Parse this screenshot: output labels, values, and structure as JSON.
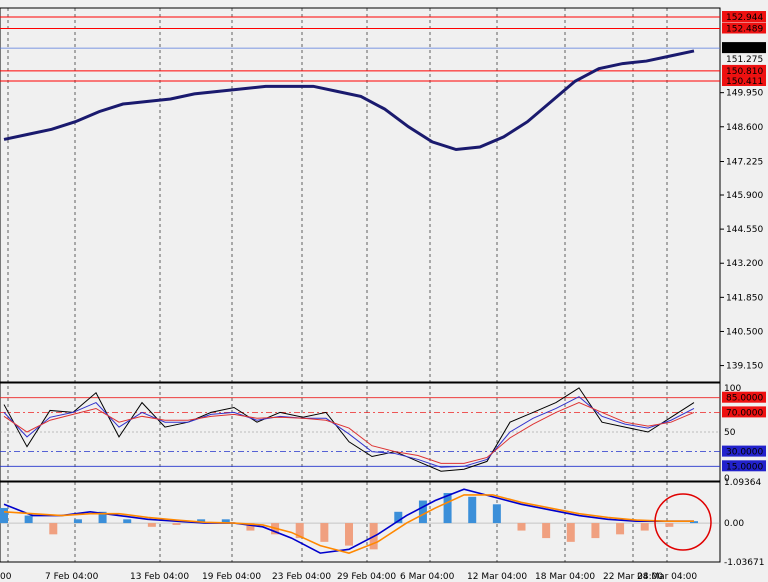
{
  "chart_data": [
    {
      "type": "line",
      "panel": "price",
      "ylim": [
        138.5,
        153.3
      ],
      "y_ticks": [
        "149.950",
        "148.600",
        "147.225",
        "145.900",
        "144.550",
        "143.200",
        "141.850",
        "140.500",
        "139.150"
      ],
      "price_labels": [
        {
          "value": 152.944,
          "text": "152.944",
          "style": "red"
        },
        {
          "value": 152.489,
          "text": "152.489",
          "style": "red"
        },
        {
          "value": 151.713,
          "text": "151.713",
          "style": "current"
        },
        {
          "value": 151.275,
          "text": "151.275",
          "style": "plain"
        },
        {
          "value": 150.81,
          "text": "150.810",
          "style": "red"
        },
        {
          "value": 150.411,
          "text": "150.411",
          "style": "red"
        }
      ],
      "horizontal_lines": [
        152.944,
        152.489,
        150.81,
        150.411
      ],
      "current_price_line": 151.713,
      "series": [
        {
          "color": "#1a1a6e",
          "values": [
            148.1,
            148.3,
            148.5,
            148.8,
            149.2,
            149.5,
            149.6,
            149.7,
            149.9,
            150.0,
            150.1,
            150.2,
            150.2,
            150.2,
            150.0,
            149.8,
            149.3,
            148.6,
            148.0,
            147.7,
            147.8,
            148.2,
            148.8,
            149.6,
            150.4,
            150.9,
            151.1,
            151.2,
            151.4,
            151.6
          ]
        }
      ],
      "x_index_range": [
        0,
        29
      ],
      "color_accent": "#ff0000",
      "background": "#f0f0f0"
    },
    {
      "type": "line",
      "panel": "stochastic",
      "ylim": [
        0,
        100
      ],
      "y_ticks": [
        "100",
        "50",
        "0"
      ],
      "levels": [
        {
          "value": 85,
          "text": "85.0000",
          "style": "red"
        },
        {
          "value": 70,
          "text": "70.0000",
          "style": "red"
        },
        {
          "value": 30,
          "text": "30.0000",
          "style": "blue"
        },
        {
          "value": 15,
          "text": "15.0000",
          "style": "blue"
        }
      ],
      "series": [
        {
          "color": "#000000",
          "values": [
            78,
            35,
            72,
            70,
            90,
            45,
            80,
            55,
            60,
            70,
            75,
            60,
            70,
            65,
            70,
            40,
            25,
            30,
            20,
            10,
            12,
            20,
            60,
            70,
            80,
            95,
            60,
            55,
            50,
            65,
            80
          ]
        },
        {
          "color": "#3333cc",
          "values": [
            70,
            45,
            65,
            70,
            80,
            55,
            70,
            60,
            60,
            68,
            70,
            62,
            66,
            64,
            64,
            48,
            30,
            28,
            22,
            14,
            15,
            22,
            50,
            64,
            74,
            86,
            66,
            58,
            54,
            62,
            74
          ]
        },
        {
          "color": "#dd3333",
          "values": [
            66,
            50,
            62,
            68,
            74,
            60,
            66,
            62,
            62,
            66,
            68,
            64,
            65,
            64,
            62,
            54,
            36,
            30,
            26,
            18,
            18,
            24,
            44,
            58,
            70,
            80,
            70,
            60,
            56,
            60,
            70
          ]
        }
      ]
    },
    {
      "type": "bar",
      "panel": "macd",
      "ylim": [
        -1.03671,
        1.09364
      ],
      "y_ticks": [
        "1.09364",
        "0.00",
        "-1.03671"
      ],
      "histogram": [
        0.4,
        0.2,
        -0.3,
        0.1,
        0.3,
        0.1,
        -0.1,
        -0.05,
        0.1,
        0.1,
        -0.2,
        -0.3,
        -0.4,
        -0.5,
        -0.6,
        -0.7,
        0.3,
        0.6,
        0.8,
        0.7,
        0.5,
        -0.2,
        -0.4,
        -0.5,
        -0.4,
        -0.3,
        -0.2,
        -0.1,
        0.05
      ],
      "series": [
        {
          "color": "#0000cc",
          "values": [
            0.5,
            0.2,
            0.2,
            0.3,
            0.2,
            0.1,
            0.05,
            0.0,
            0.0,
            -0.1,
            -0.4,
            -0.8,
            -0.7,
            -0.3,
            0.2,
            0.6,
            0.9,
            0.7,
            0.5,
            0.35,
            0.2,
            0.1,
            0.05,
            0.05,
            0.05
          ]
        },
        {
          "color": "#ff8800",
          "values": [
            0.3,
            0.25,
            0.2,
            0.25,
            0.25,
            0.15,
            0.08,
            0.02,
            0.0,
            -0.05,
            -0.25,
            -0.6,
            -0.8,
            -0.5,
            0.0,
            0.4,
            0.75,
            0.75,
            0.55,
            0.4,
            0.25,
            0.15,
            0.08,
            0.05,
            0.05
          ]
        }
      ]
    }
  ],
  "x_axis": {
    "tick_labels": [
      "00",
      "7 Feb 04:00",
      "13 Feb 04:00",
      "19 Feb 04:00",
      "23 Feb 04:00",
      "29 Feb 04:00",
      "6 Mar 04:00",
      "12 Mar 04:00",
      "18 Mar 04:00",
      "22 Mar 04:00",
      "28 Mar 04:00"
    ]
  }
}
